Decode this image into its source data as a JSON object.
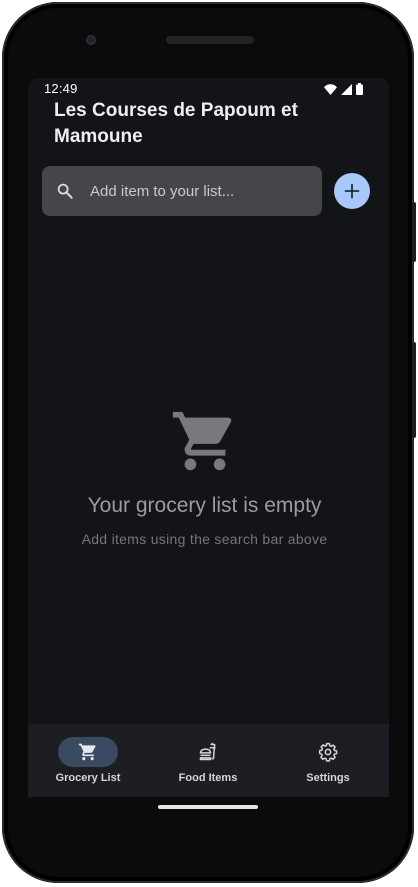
{
  "status_bar": {
    "time": "12:49",
    "icons": [
      "wifi-icon",
      "cell-signal-icon",
      "battery-icon"
    ]
  },
  "app": {
    "title": "Les Courses de Papoum et Mamoune"
  },
  "search": {
    "placeholder": "Add item to your list...",
    "value": "",
    "icon": "search-icon"
  },
  "add_button": {
    "icon": "plus-icon",
    "color": "#a8c8fa"
  },
  "empty_state": {
    "icon": "shopping-cart-icon",
    "title": "Your grocery list is empty",
    "subtitle": "Add items using the search bar above"
  },
  "bottom_nav": {
    "items": [
      {
        "label": "Grocery List",
        "icon": "shopping-cart-icon",
        "active": true
      },
      {
        "label": "Food Items",
        "icon": "fastfood-icon",
        "active": false
      },
      {
        "label": "Settings",
        "icon": "gear-icon",
        "active": false
      }
    ]
  },
  "colors": {
    "background": "#121418",
    "nav_background": "#1c1e23",
    "search_background": "#45464a",
    "active_indicator": "#3a4a60",
    "accent": "#a8c8fa"
  }
}
